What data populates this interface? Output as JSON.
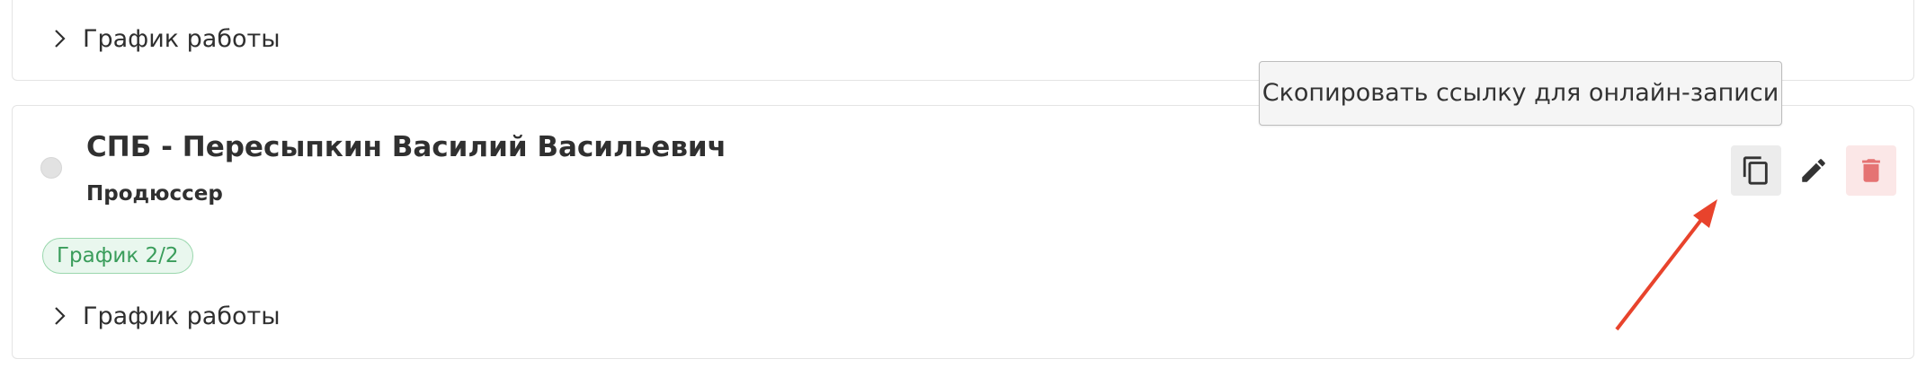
{
  "top_card": {
    "schedule_label": "График работы"
  },
  "employee": {
    "name": "СПБ - Пересыпкин Василий Васильевич",
    "role": "Продюссер",
    "badge": "График 2/2",
    "schedule_label": "График работы"
  },
  "actions": {
    "copy_icon": "copy-icon",
    "edit_icon": "pencil-icon",
    "delete_icon": "trash-icon"
  },
  "tooltip": {
    "text": "Скопировать ссылку для онлайн-записи"
  },
  "colors": {
    "badge_text": "#3a9d5b",
    "badge_bg": "#e9f7ee",
    "delete": "#e57373",
    "arrow": "#e8432c"
  }
}
